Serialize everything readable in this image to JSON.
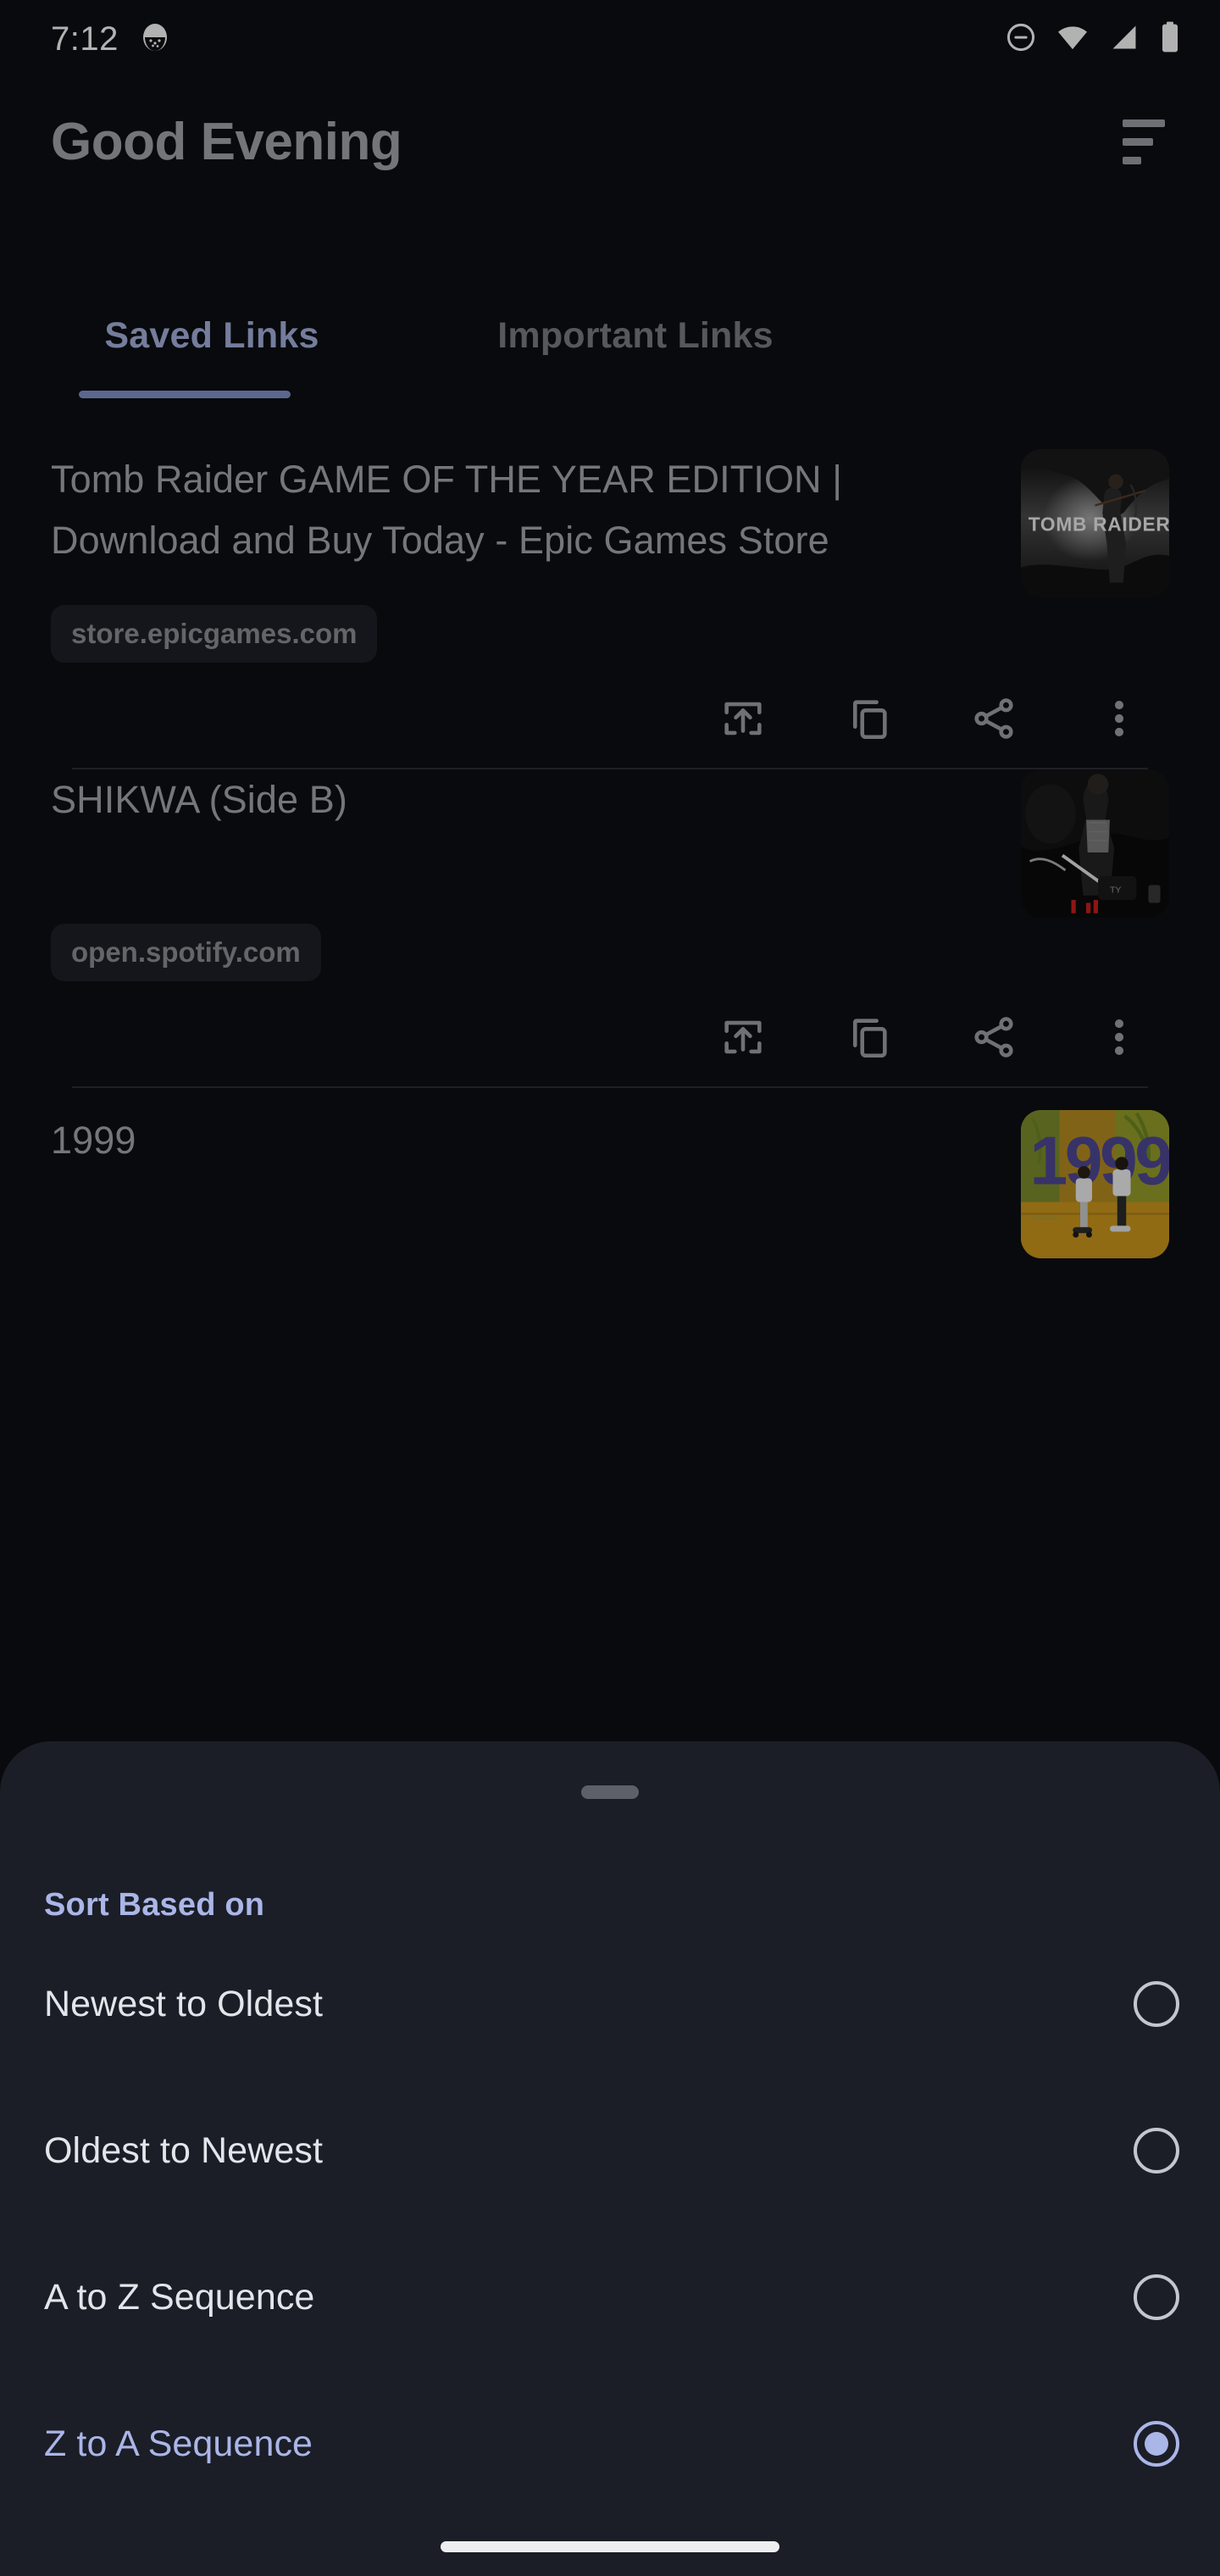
{
  "status_bar": {
    "time": "7:12",
    "icons": [
      "notification-dot-icon",
      "do-not-disturb-icon",
      "wifi-icon",
      "cellular-signal-icon",
      "battery-icon"
    ]
  },
  "header": {
    "title": "Good Evening",
    "sort_icon": "sort-lines-icon"
  },
  "tabs": [
    {
      "label": "Saved Links",
      "active": true
    },
    {
      "label": "Important Links",
      "active": false
    }
  ],
  "links": [
    {
      "title": "Tomb Raider GAME OF THE YEAR EDITION | Download and Buy Today - Epic Games Store",
      "domain": "store.epicgames.com",
      "thumbnail": "tomb-raider-cover",
      "actions": [
        "open-in-browser-icon",
        "copy-icon",
        "share-icon",
        "more-options-icon"
      ]
    },
    {
      "title": "SHIKWA (Side B)",
      "domain": "open.spotify.com",
      "thumbnail": "shikwa-cover",
      "actions": [
        "open-in-browser-icon",
        "copy-icon",
        "share-icon",
        "more-options-icon"
      ]
    },
    {
      "title": "1999",
      "domain": "",
      "thumbnail": "1999-cover",
      "actions": []
    }
  ],
  "sort_sheet": {
    "header": "Sort Based on",
    "options": [
      {
        "label": "Newest to Oldest",
        "selected": false
      },
      {
        "label": "Oldest to Newest",
        "selected": false
      },
      {
        "label": "A to Z Sequence",
        "selected": false
      },
      {
        "label": "Z to A Sequence",
        "selected": true
      }
    ]
  },
  "colors": {
    "background": "#0d0f14",
    "sheet_background": "#1b1e26",
    "accent": "#aab6e8",
    "tab_active": "#a8b3e0",
    "text_primary": "#a7a9ae",
    "text_muted": "#7b7e85",
    "chip_background": "#1d2028",
    "divider": "#2b2e35"
  }
}
